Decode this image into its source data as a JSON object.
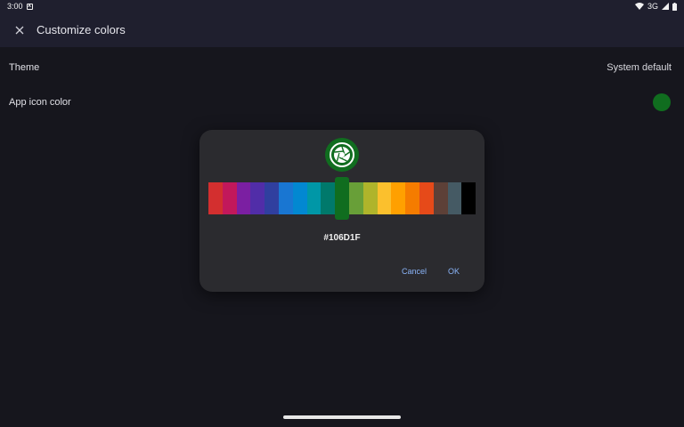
{
  "status_bar": {
    "time": "3:00",
    "network": "3G"
  },
  "app_bar": {
    "title": "Customize colors"
  },
  "settings": {
    "theme": {
      "label": "Theme",
      "value": "System default"
    },
    "app_icon_color": {
      "label": "App icon color",
      "color": "#106D1F"
    }
  },
  "dialog": {
    "selected_hex": "#106D1F",
    "selected_color": "#106D1F",
    "swatches": [
      "#d32f2f",
      "#c2185b",
      "#7b1fa2",
      "#512da8",
      "#303f9f",
      "#1976d2",
      "#0288d1",
      "#0097a7",
      "#00796b",
      "#106D1F",
      "#689f38",
      "#afb42b",
      "#fbc02d",
      "#ffa000",
      "#f57c00",
      "#e64a19",
      "#5d4037",
      "#455a64",
      "#000000"
    ],
    "selected_index": 9,
    "cancel_label": "Cancel",
    "ok_label": "OK"
  }
}
